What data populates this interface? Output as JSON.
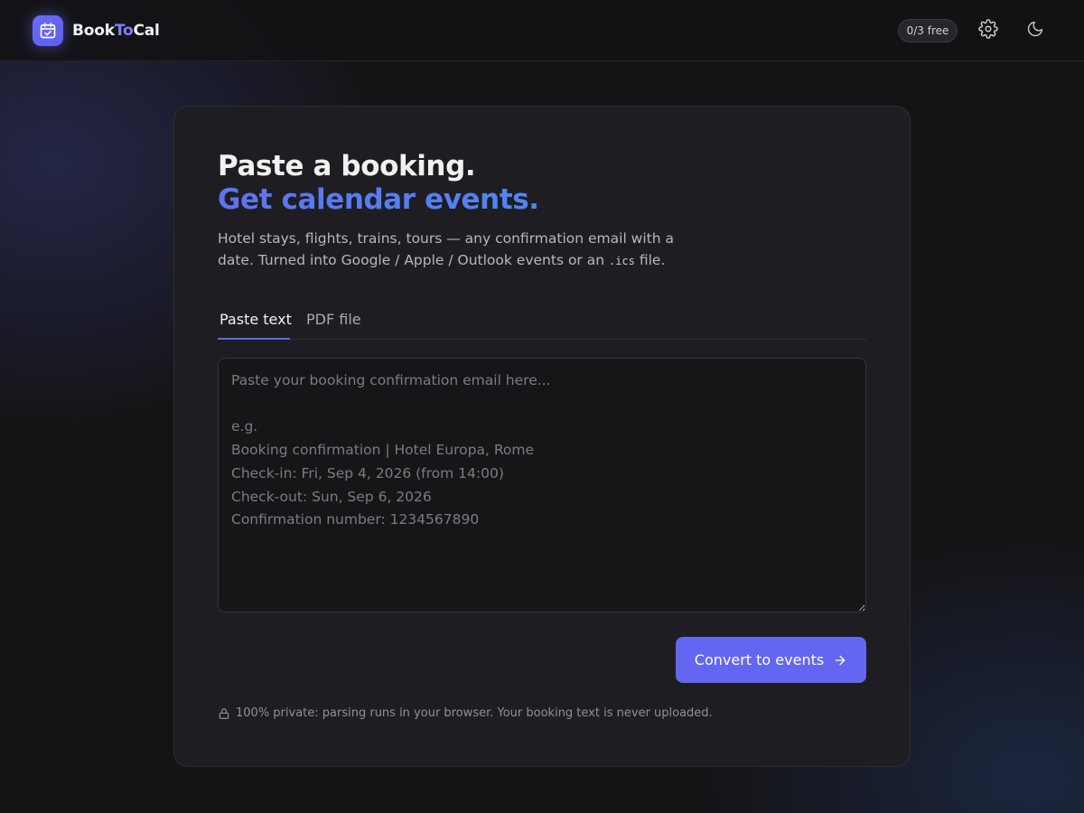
{
  "app": {
    "name_part1": "Book",
    "name_part2": "To",
    "name_part3": "Cal",
    "logo_icon": "calendar-check-icon"
  },
  "header": {
    "usage_badge": "0/3 free",
    "settings_icon": "gear-icon",
    "theme_icon": "moon-icon"
  },
  "hero": {
    "title_line1": "Paste a booking.",
    "title_line2": "Get calendar events.",
    "subtitle_before": "Hotel stays, flights, trains, tours — any confirmation email with a date. Turned into Google / Apple / Outlook events or an ",
    "subtitle_code": ".ics",
    "subtitle_after": " file."
  },
  "tabs": [
    {
      "label": "Paste text",
      "active": true
    },
    {
      "label": "PDF file",
      "active": false
    }
  ],
  "input": {
    "value": "",
    "placeholder": "Paste your booking confirmation email here...\n\ne.g.\nBooking confirmation | Hotel Europa, Rome\nCheck-in: Fri, Sep 4, 2026 (from 14:00)\nCheck-out: Sun, Sep 6, 2026\nConfirmation number: 1234567890"
  },
  "actions": {
    "convert_label": "Convert to events",
    "convert_icon": "arrow-right-icon"
  },
  "footer": {
    "privacy_icon": "lock-icon",
    "privacy_text": "100% private: parsing runs in your browser. Your booking text is never uploaded."
  },
  "colors": {
    "accent": "#6366f1",
    "background": "#141416",
    "card": "#1e1e22",
    "title_gradient_start": "#5f73f0",
    "title_gradient_end": "#4f86f2"
  }
}
